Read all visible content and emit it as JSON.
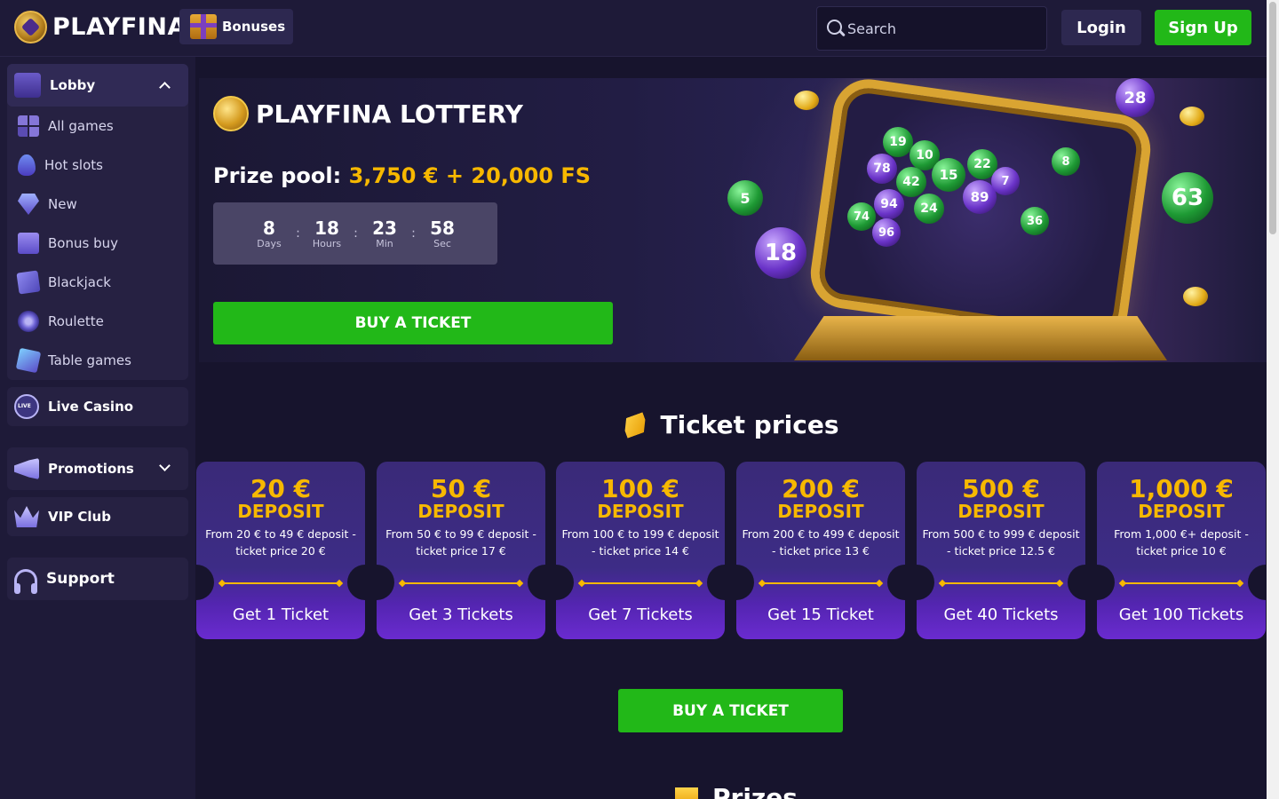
{
  "header": {
    "brand": "PLAYFINA",
    "bonuses_label": "Bonuses",
    "search_placeholder": "Search",
    "login_label": "Login",
    "signup_label": "Sign Up"
  },
  "sidebar": {
    "lobby": {
      "label": "Lobby",
      "items": [
        {
          "label": "All games",
          "icon": "grid-icon"
        },
        {
          "label": "Hot slots",
          "icon": "fire-icon"
        },
        {
          "label": "New",
          "icon": "diamond-icon"
        },
        {
          "label": "Bonus buy",
          "icon": "gift-icon"
        },
        {
          "label": "Blackjack",
          "icon": "cards-icon"
        },
        {
          "label": "Roulette",
          "icon": "roulette-icon"
        },
        {
          "label": "Table games",
          "icon": "dice-icon"
        }
      ]
    },
    "live_casino": "Live Casino",
    "promotions": "Promotions",
    "vip_club": "VIP Club",
    "support": "Support"
  },
  "hero": {
    "title": "PLAYFINA LOTTERY",
    "prize_label": "Prize pool:",
    "prize_amount": "3,750 € + 20,000 FS",
    "countdown": [
      {
        "value": "8",
        "label": "Days"
      },
      {
        "value": "18",
        "label": "Hours"
      },
      {
        "value": "23",
        "label": "Min"
      },
      {
        "value": "58",
        "label": "Sec"
      }
    ],
    "cta": "BUY A TICKET",
    "balls": [
      "19",
      "10",
      "78",
      "15",
      "22",
      "42",
      "94",
      "89",
      "24",
      "74",
      "96",
      "36",
      "8",
      "5",
      "18",
      "28",
      "63",
      "7"
    ]
  },
  "ticket_prices": {
    "title": "Ticket prices",
    "cards": [
      {
        "amount": "20 €",
        "deposit": "DEPOSIT",
        "desc": "From 20 € to 49 € deposit - ticket price 20 €",
        "cta": "Get 1 Ticket"
      },
      {
        "amount": "50 €",
        "deposit": "DEPOSIT",
        "desc": "From 50 € to 99 € deposit - ticket price 17 €",
        "cta": "Get 3 Tickets"
      },
      {
        "amount": "100 €",
        "deposit": "DEPOSIT",
        "desc": "From 100 € to 199 € deposit - ticket price 14 €",
        "cta": "Get 7 Tickets"
      },
      {
        "amount": "200 €",
        "deposit": "DEPOSIT",
        "desc": "From 200 € to 499 € deposit - ticket price 13 €",
        "cta": "Get 15 Ticket"
      },
      {
        "amount": "500 €",
        "deposit": "DEPOSIT",
        "desc": "From 500 € to 999 € deposit - ticket price 12.5 €",
        "cta": "Get 40 Tickets"
      },
      {
        "amount": "1,000 €",
        "deposit": "DEPOSIT",
        "desc": "From 1,000 €+ deposit - ticket price 10 €",
        "cta": "Get 100 Tickets"
      }
    ],
    "cta": "BUY A TICKET"
  },
  "prizes": {
    "title": "Prizes"
  },
  "colors": {
    "accent_green": "#22b818",
    "accent_gold": "#f7b800",
    "background": "#17142d",
    "card_purple": "#3d2c86"
  }
}
